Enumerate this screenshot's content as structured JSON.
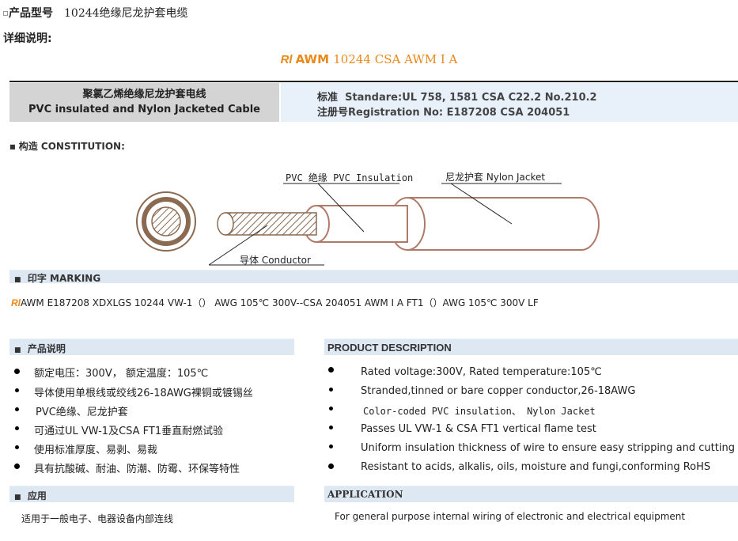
{
  "header": {
    "model_label": "产品型号",
    "model_value": "10244绝缘尼龙护套电缆",
    "detail_label": "详细说明:"
  },
  "standard_title": {
    "ul_mark": "Rl",
    "awm": "AWM",
    "rest": "10244 CSA AWM Ⅰ A"
  },
  "cable_box": {
    "name_cn": "聚氯乙烯绝缘尼龙护套电线",
    "name_en": "PVC insulated and Nylon Jacketed Cable",
    "std_prefix": "标准",
    "std_value": "Standare:UL 758, 1581 CSA C22.2 No.210.2",
    "reg_prefix": "注册号",
    "reg_value": "Registration No: E187208 CSA 204051"
  },
  "construction": {
    "title": "构造  CONSTITUTION:",
    "label_insulation": "PVC 绝缘 PVC Insulation",
    "label_jacket": "尼龙护套 Nylon Jacket",
    "label_conductor": "导体 Conductor"
  },
  "marking": {
    "title": "印字 MARKING",
    "text": "AWM E187208 XDXLGS 10244 VW-1（） AWG 105℃ 300V--CSA 204051 AWM I A FT1（）AWG 105℃ 300V  LF"
  },
  "product_cn": {
    "title": "产品说明",
    "items": [
      "额定电压：300V， 额定温度：105℃",
      "导体使用单根线或绞线26-18AWG裸铜或镀锡丝",
      "PVC绝缘、尼龙护套",
      "可通过UL VW-1及CSA FT1垂直耐燃试验",
      "使用标准厚度、易剥、易裁",
      "具有抗酸碱、耐油、防潮、防霉、环保等特性"
    ]
  },
  "product_en": {
    "title": "PRODUCT DESCRIPTION",
    "items": [
      "Rated voltage:300V, Rated temperature:105℃",
      "Stranded,tinned or bare  copper conductor,26-18AWG",
      "Color-coded PVC insulation、 Nylon Jacket",
      "Passes UL VW-1 & CSA FT1 vertical flame test",
      "Uniform insulation thickness of wire to ensure easy stripping and cutting",
      "Resistant to acids, alkalis, oils, moisture and fungi,conforming RoHS"
    ]
  },
  "application_cn": {
    "title": "应用",
    "text": "适用于一般电子、电器设备内部连线"
  },
  "application_en": {
    "title": "APPLICATION",
    "text": "For general purpose internal wiring of electronic and electrical equipment"
  },
  "colors": {
    "accent_orange": "#e8891a",
    "bar_blue": "#dde8f2",
    "box_gray": "#d4d4d4"
  }
}
